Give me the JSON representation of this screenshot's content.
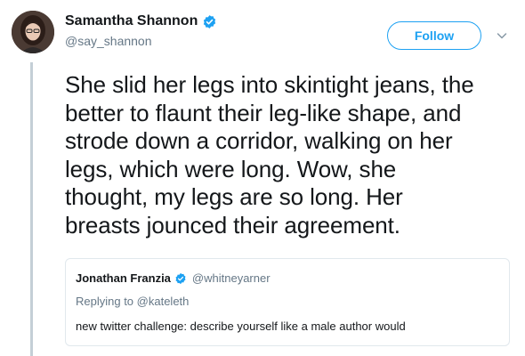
{
  "author": {
    "display_name": "Samantha Shannon",
    "handle": "@say_shannon",
    "verified": true
  },
  "follow_button": {
    "label": "Follow"
  },
  "tweet": {
    "lines": [
      "She slid her legs into skintight jeans, the",
      "better to flaunt their leg-like shape, and",
      "strode down a corridor, walking on her",
      "legs, which were long. Wow, she",
      "thought, my legs are so long. Her",
      "breasts jounced their agreement."
    ]
  },
  "quoted_tweet": {
    "display_name": "Jonathan Franzia",
    "handle": "@whitneyarner",
    "verified": true,
    "replying_prefix": "Replying to ",
    "replying_to": "@kateleth",
    "text": "new twitter challenge: describe yourself like a male author would"
  },
  "colors": {
    "accent": "#1da1f2",
    "secondary_text": "#657786",
    "border": "#e1e8ed",
    "thread_line": "#c4cfd6"
  }
}
